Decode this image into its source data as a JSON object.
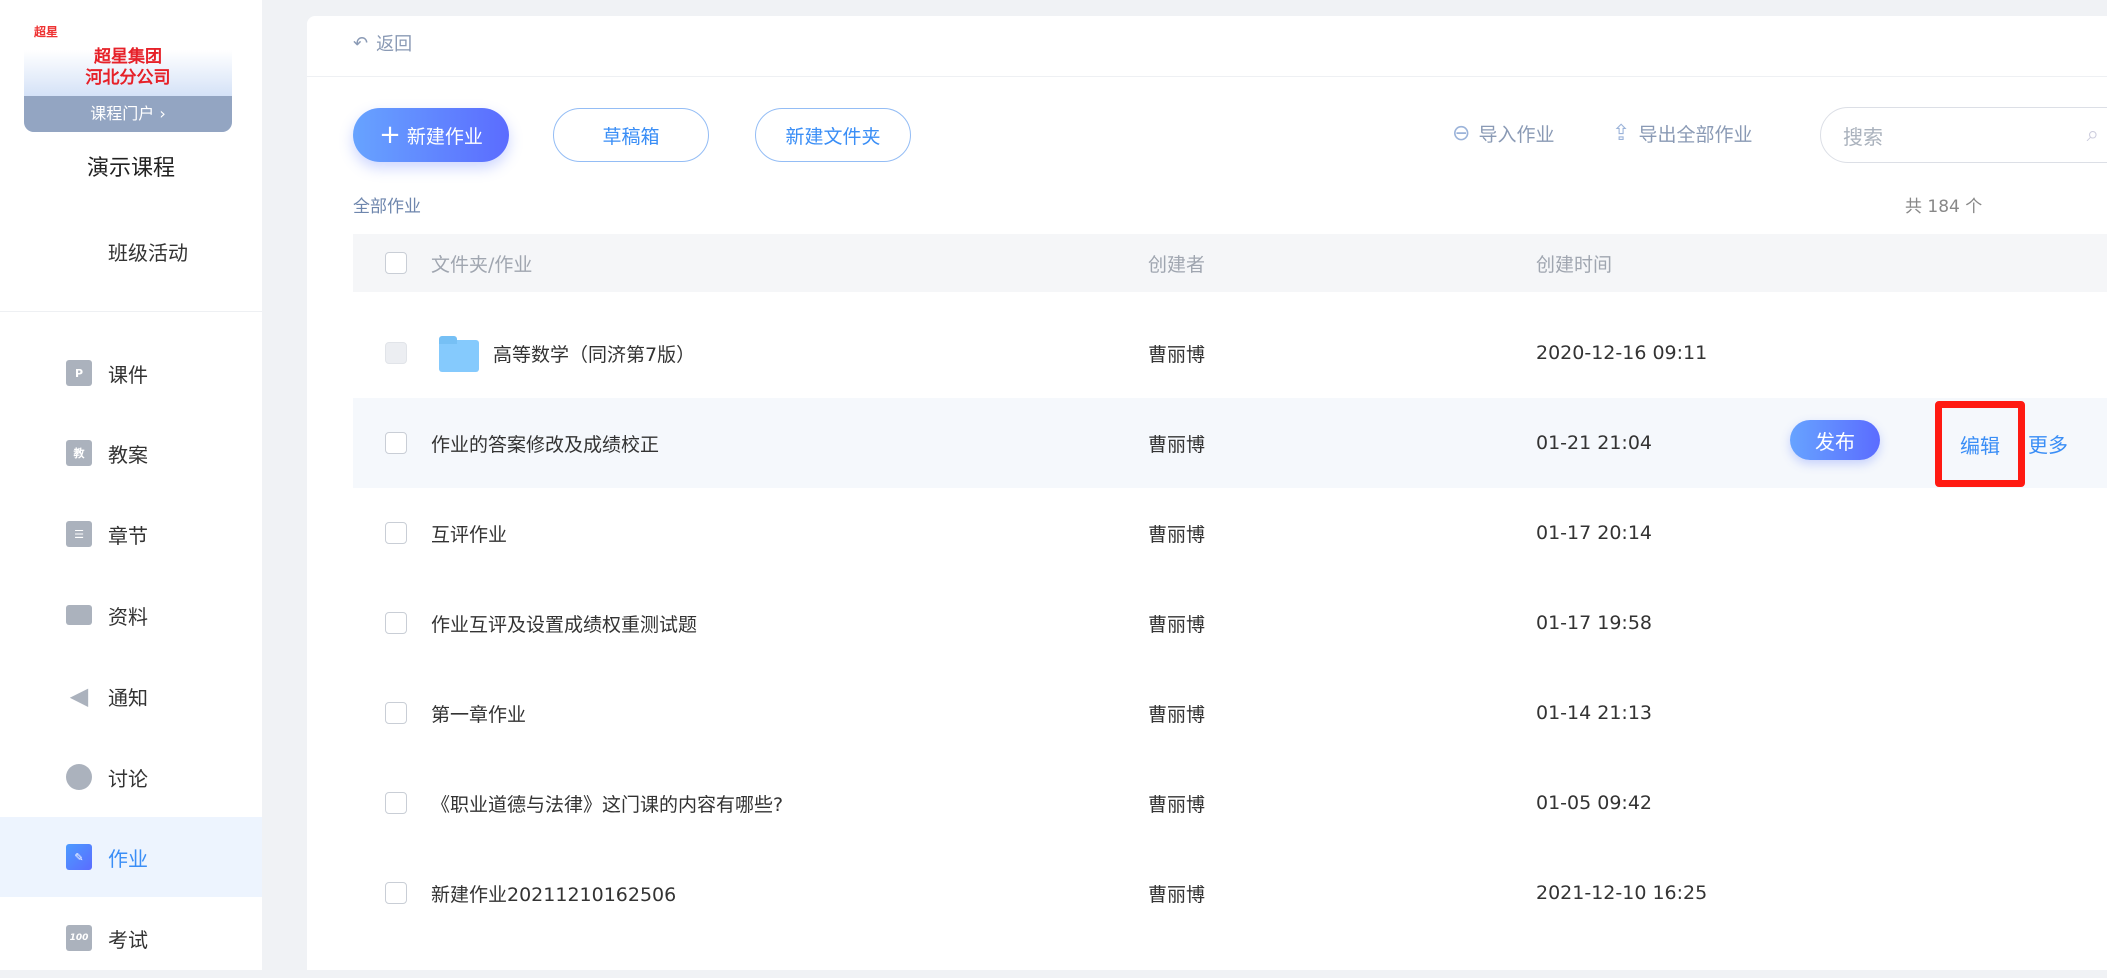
{
  "sidebar": {
    "logo": {
      "mark": "超星",
      "org_line1": "超星集团",
      "org_line2": "河北分公司",
      "portal": "课程门户 ›"
    },
    "course_title": "演示课程",
    "items": [
      {
        "label": "班级活动",
        "icon": "grid-icon"
      },
      {
        "label": "课件",
        "icon": "ppt-file-icon",
        "glyph": "P"
      },
      {
        "label": "教案",
        "icon": "lesson-plan-icon",
        "glyph": "教"
      },
      {
        "label": "章节",
        "icon": "list-icon",
        "glyph": "☰"
      },
      {
        "label": "资料",
        "icon": "folder-icon"
      },
      {
        "label": "通知",
        "icon": "speaker-icon",
        "glyph": "◀"
      },
      {
        "label": "讨论",
        "icon": "chat-icon"
      },
      {
        "label": "作业",
        "icon": "homework-icon",
        "glyph": "✎",
        "active": true
      },
      {
        "label": "考试",
        "icon": "exam-icon",
        "glyph": "100"
      }
    ]
  },
  "main": {
    "back": "返回",
    "new_homework": "新建作业",
    "drafts": "草稿箱",
    "new_folder": "新建文件夹",
    "import": "导入作业",
    "export": "导出全部作业",
    "search_placeholder": "搜索",
    "breadcrumb": "全部作业",
    "total": "共 184 个",
    "columns": [
      "文件夹/作业",
      "创建者",
      "创建时间"
    ],
    "rows": [
      {
        "name": "高等数学（同济第7版）",
        "creator": "曹丽博",
        "time": "2020-12-16 09:11",
        "folder": true
      },
      {
        "name": "作业的答案修改及成绩校正",
        "creator": "曹丽博",
        "time": "01-21 21:04",
        "hover": true
      },
      {
        "name": "互评作业",
        "creator": "曹丽博",
        "time": "01-17 20:14"
      },
      {
        "name": "作业互评及设置成绩权重测试题",
        "creator": "曹丽博",
        "time": "01-17 19:58"
      },
      {
        "name": "第一章作业",
        "creator": "曹丽博",
        "time": "01-14 21:13"
      },
      {
        "name": "《职业道德与法律》这门课的内容有哪些?",
        "creator": "曹丽博",
        "time": "01-05 09:42"
      },
      {
        "name": "新建作业20211210162506",
        "creator": "曹丽博",
        "time": "2021-12-10 16:25"
      }
    ],
    "row_actions": {
      "publish": "发布",
      "edit": "编辑",
      "more": "更多"
    }
  },
  "colors": {
    "accent": "#3a8ef6",
    "highlight_box": "#ff1a12"
  }
}
